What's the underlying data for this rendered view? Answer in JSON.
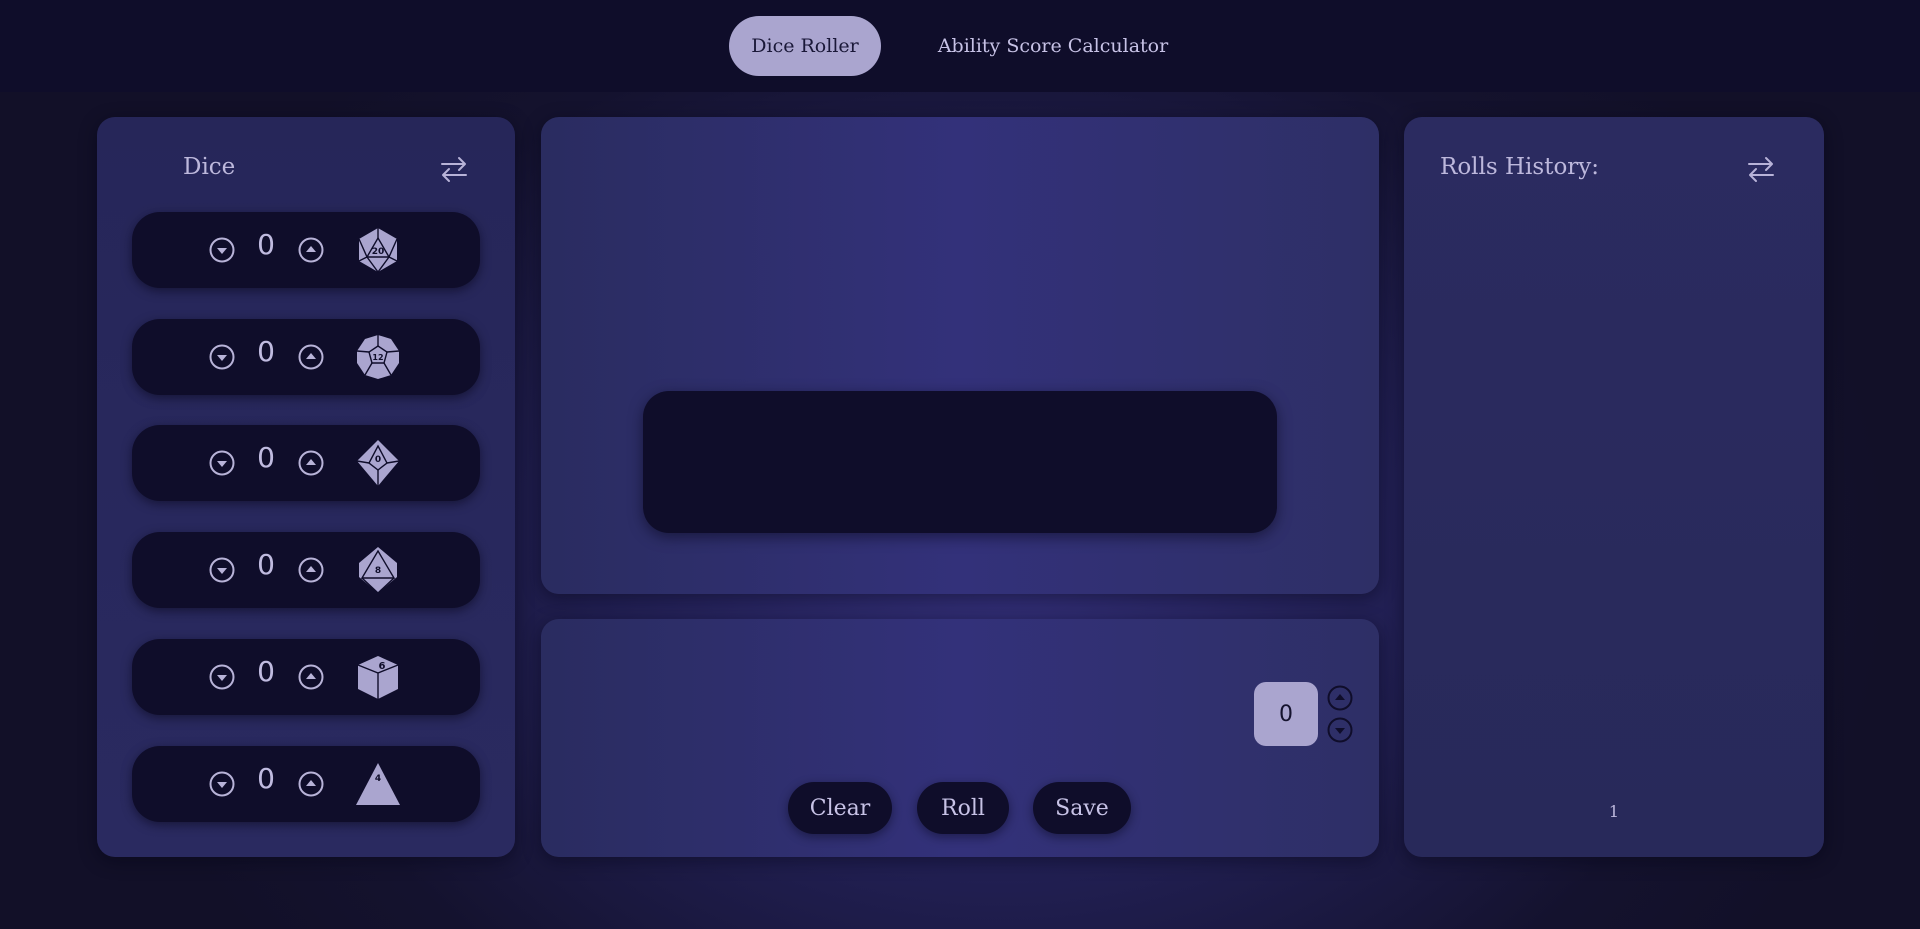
{
  "nav": {
    "tabs": [
      {
        "label": "Dice Roller",
        "active": true
      },
      {
        "label": "Ability Score Calculator",
        "active": false
      }
    ]
  },
  "dice_panel": {
    "title": "Dice",
    "swap_icon": "swap-arrows-icon",
    "rows": [
      {
        "count": "0",
        "die_label": "20",
        "die_icon": "d20-icon"
      },
      {
        "count": "0",
        "die_label": "12",
        "die_icon": "d12-icon"
      },
      {
        "count": "0",
        "die_label": "0",
        "die_icon": "d10-icon"
      },
      {
        "count": "0",
        "die_label": "8",
        "die_icon": "d8-icon"
      },
      {
        "count": "0",
        "die_label": "6",
        "die_icon": "d6-icon"
      },
      {
        "count": "0",
        "die_label": "4",
        "die_icon": "d4-icon"
      }
    ]
  },
  "controls": {
    "modifier": "0",
    "clear_label": "Clear",
    "roll_label": "Roll",
    "save_label": "Save"
  },
  "history": {
    "title": "Rolls History:",
    "page": "1"
  },
  "colors": {
    "nav_bg": "#0f0d2a",
    "accent": "#aaa5cf",
    "panel": "#2a2a60",
    "text": "#bdb8dc"
  }
}
